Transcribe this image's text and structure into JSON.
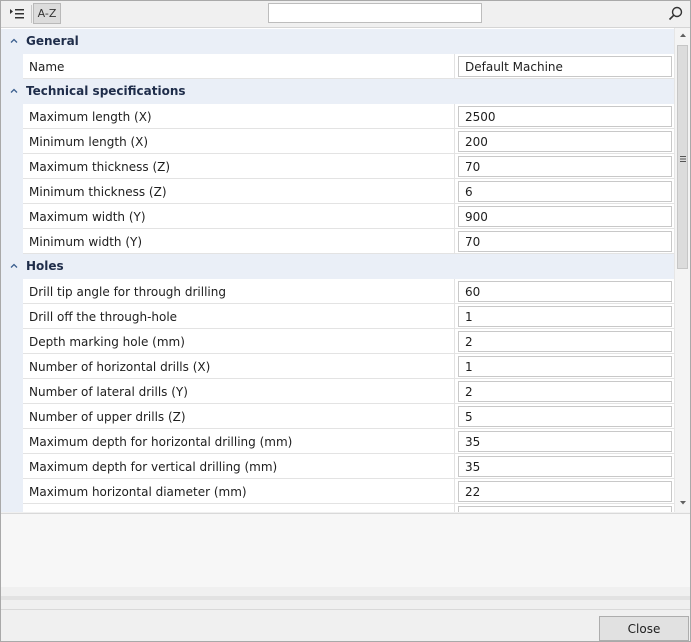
{
  "toolbar": {
    "categorized_icon": "categorized-view-icon",
    "az_label": "A-Z",
    "search_value": "",
    "search_icon": "search-icon"
  },
  "grid": {
    "categories": [
      {
        "label": "General",
        "rows": [
          {
            "label": "Name",
            "value": "Default Machine"
          }
        ]
      },
      {
        "label": "Technical specifications",
        "rows": [
          {
            "label": "Maximum length (X)",
            "value": "2500"
          },
          {
            "label": "Minimum length (X)",
            "value": "200"
          },
          {
            "label": "Maximum thickness (Z)",
            "value": "70"
          },
          {
            "label": "Minimum thickness (Z)",
            "value": "6"
          },
          {
            "label": "Maximum width (Y)",
            "value": "900"
          },
          {
            "label": "Minimum width (Y)",
            "value": "70"
          }
        ]
      },
      {
        "label": "Holes",
        "rows": [
          {
            "label": "Drill tip angle for through drilling",
            "value": "60"
          },
          {
            "label": "Drill off the through-hole",
            "value": "1"
          },
          {
            "label": "Depth marking hole (mm)",
            "value": "2"
          },
          {
            "label": "Number of horizontal drills (X)",
            "value": "1"
          },
          {
            "label": "Number of lateral drills (Y)",
            "value": "2"
          },
          {
            "label": "Number of upper drills (Z)",
            "value": "5"
          },
          {
            "label": "Maximum depth for horizontal drilling (mm)",
            "value": "35"
          },
          {
            "label": "Maximum depth for vertical drilling (mm)",
            "value": "35"
          },
          {
            "label": "Maximum horizontal diameter (mm)",
            "value": "22"
          },
          {
            "label": "",
            "value": ""
          }
        ]
      }
    ]
  },
  "footer": {
    "close_label": "Close"
  }
}
